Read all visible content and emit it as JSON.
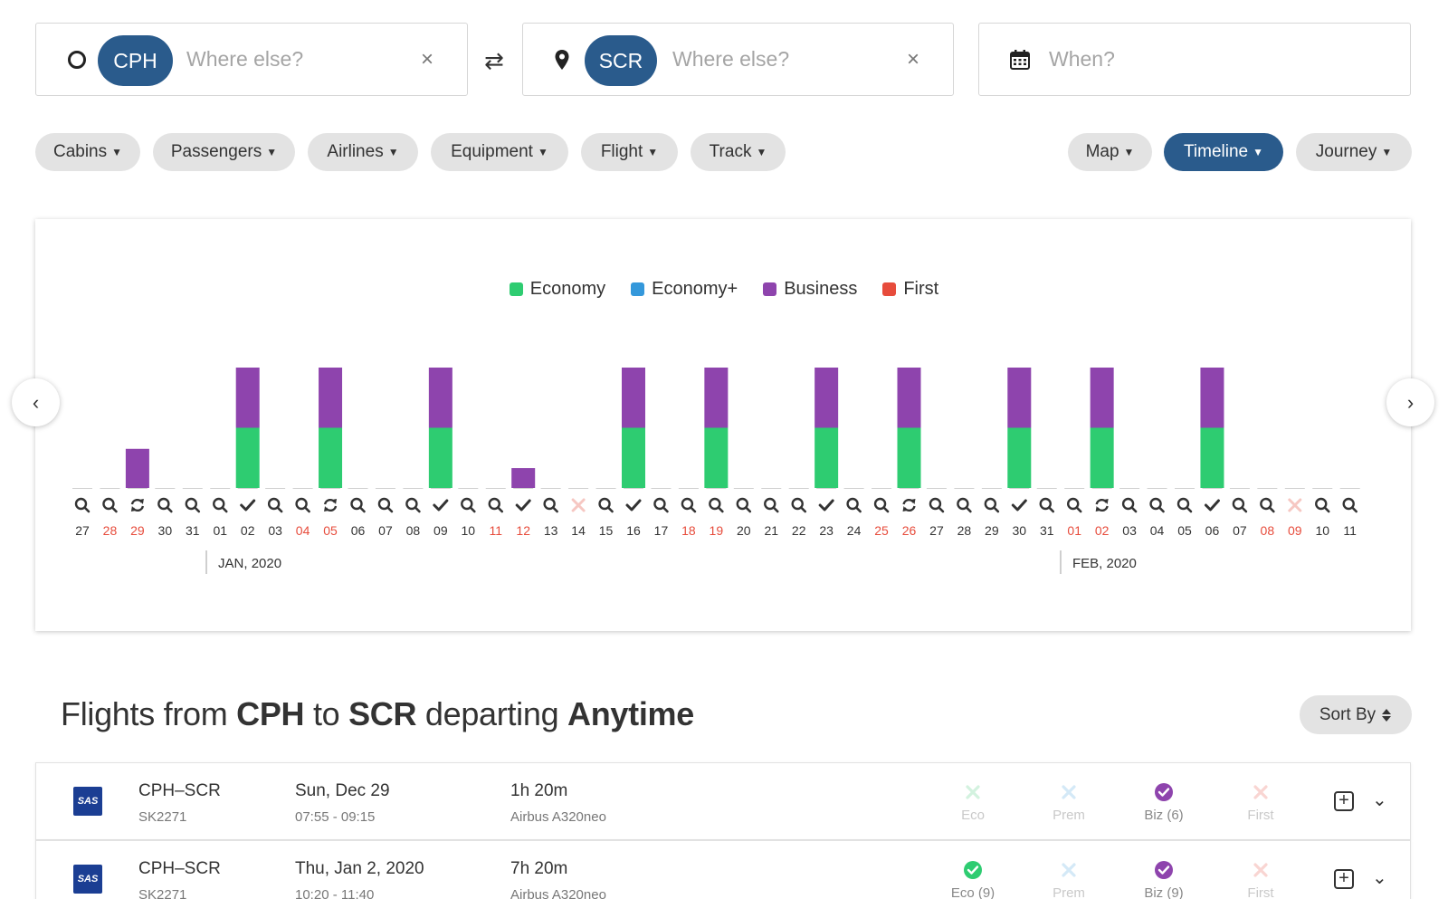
{
  "search": {
    "origin": {
      "code": "CPH",
      "placeholder": "Where else?",
      "clear": "×"
    },
    "swap": "⇄",
    "destination": {
      "code": "SCR",
      "placeholder": "Where else?",
      "clear": "×"
    },
    "when": {
      "placeholder": "When?"
    }
  },
  "filters": [
    "Cabins",
    "Passengers",
    "Airlines",
    "Equipment",
    "Flight",
    "Track"
  ],
  "views": {
    "items": [
      "Map",
      "Timeline",
      "Journey"
    ],
    "active": "Timeline"
  },
  "legend": [
    {
      "label": "Economy",
      "color": "#2ecc71"
    },
    {
      "label": "Economy+",
      "color": "#3498db"
    },
    {
      "label": "Business",
      "color": "#8e44ad"
    },
    {
      "label": "First",
      "color": "#e74c3c"
    }
  ],
  "chart_data": {
    "type": "bar",
    "stacked": true,
    "categories": [
      "27",
      "28",
      "29",
      "30",
      "31",
      "01",
      "02",
      "03",
      "04",
      "05",
      "06",
      "07",
      "08",
      "09",
      "10",
      "11",
      "12",
      "13",
      "14",
      "15",
      "16",
      "17",
      "18",
      "19",
      "20",
      "21",
      "22",
      "23",
      "24",
      "25",
      "26",
      "27",
      "28",
      "29",
      "30",
      "31",
      "01",
      "02",
      "03",
      "04",
      "05",
      "06",
      "07",
      "08",
      "09",
      "10",
      "11"
    ],
    "weekend": [
      false,
      true,
      true,
      false,
      false,
      false,
      false,
      false,
      true,
      true,
      false,
      false,
      false,
      false,
      false,
      true,
      true,
      false,
      false,
      false,
      false,
      false,
      true,
      true,
      false,
      false,
      false,
      false,
      false,
      true,
      true,
      false,
      false,
      false,
      false,
      false,
      true,
      true,
      false,
      false,
      false,
      false,
      false,
      true,
      true,
      false,
      false
    ],
    "status_icons": [
      "search",
      "search",
      "sync",
      "search",
      "search",
      "search",
      "check",
      "search",
      "search",
      "sync",
      "search",
      "search",
      "search",
      "check",
      "search",
      "search",
      "check",
      "search",
      "x",
      "search",
      "check",
      "search",
      "search",
      "search",
      "search",
      "search",
      "search",
      "check",
      "search",
      "search",
      "sync",
      "search",
      "search",
      "search",
      "check",
      "search",
      "search",
      "sync",
      "search",
      "search",
      "search",
      "check",
      "search",
      "search",
      "x",
      "search",
      "search"
    ],
    "series": [
      {
        "name": "Economy",
        "color": "#2ecc71",
        "values": [
          0,
          0,
          0,
          0,
          0,
          0,
          1,
          0,
          0,
          1,
          0,
          0,
          0,
          1,
          0,
          0,
          0,
          0,
          0,
          0,
          1,
          0,
          0,
          1,
          0,
          0,
          0,
          1,
          0,
          0,
          1,
          0,
          0,
          0,
          1,
          0,
          0,
          1,
          0,
          0,
          0,
          1,
          0,
          0,
          0,
          0,
          0
        ]
      },
      {
        "name": "Economy+",
        "color": "#3498db",
        "values": [
          0,
          0,
          0,
          0,
          0,
          0,
          0,
          0,
          0,
          0,
          0,
          0,
          0,
          0,
          0,
          0,
          0,
          0,
          0,
          0,
          0,
          0,
          0,
          0,
          0,
          0,
          0,
          0,
          0,
          0,
          0,
          0,
          0,
          0,
          0,
          0,
          0,
          0,
          0,
          0,
          0,
          0,
          0,
          0,
          0,
          0,
          0
        ]
      },
      {
        "name": "Business",
        "color": "#8e44ad",
        "values": [
          0,
          0,
          0.65,
          0,
          0,
          0,
          1,
          0,
          0,
          1,
          0,
          0,
          0,
          1,
          0,
          0,
          0.33,
          0,
          0,
          0,
          1,
          0,
          0,
          1,
          0,
          0,
          0,
          1,
          0,
          0,
          1,
          0,
          0,
          0,
          1,
          0,
          0,
          1,
          0,
          0,
          0,
          1,
          0,
          0,
          0,
          0,
          0
        ]
      },
      {
        "name": "First",
        "color": "#e74c3c",
        "values": [
          0,
          0,
          0,
          0,
          0,
          0,
          0,
          0,
          0,
          0,
          0,
          0,
          0,
          0,
          0,
          0,
          0,
          0,
          0,
          0,
          0,
          0,
          0,
          0,
          0,
          0,
          0,
          0,
          0,
          0,
          0,
          0,
          0,
          0,
          0,
          0,
          0,
          0,
          0,
          0,
          0,
          0,
          0,
          0,
          0,
          0,
          0
        ]
      }
    ],
    "month_labels": [
      {
        "label": "JAN, 2020",
        "index": 5
      },
      {
        "label": "FEB, 2020",
        "index": 36
      }
    ]
  },
  "results": {
    "title_parts": [
      "Flights from ",
      "CPH",
      " to ",
      "SCR",
      " departing ",
      "Anytime"
    ],
    "sort_label": "Sort By",
    "flights": [
      {
        "logo": "SAS",
        "route": "CPH–SCR",
        "flight_no": "SK2271",
        "date": "Sun, Dec 29",
        "time": "07:55 - 09:15",
        "duration": "1h 20m",
        "aircraft": "Airbus A320neo",
        "cabins": [
          {
            "label": "Eco",
            "status": "unavailable"
          },
          {
            "label": "Prem",
            "status": "unavailable"
          },
          {
            "label": "Biz (6)",
            "status": "available"
          },
          {
            "label": "First",
            "status": "unavailable"
          }
        ]
      },
      {
        "logo": "SAS",
        "route": "CPH–SCR",
        "flight_no": "SK2271",
        "date": "Thu, Jan 2, 2020",
        "time": "10:20 - 11:40",
        "duration": "7h 20m",
        "aircraft": "Airbus A320neo",
        "cabins": [
          {
            "label": "Eco (9)",
            "status": "available"
          },
          {
            "label": "Prem",
            "status": "unavailable"
          },
          {
            "label": "Biz (9)",
            "status": "available"
          },
          {
            "label": "First",
            "status": "unavailable"
          }
        ]
      }
    ]
  },
  "colors": {
    "brand": "#2a5b8c",
    "weekend": "#e74c3c",
    "eco_ok": "#2ecc71",
    "biz_ok": "#8e44ad",
    "prem_off": "#d4e9f7",
    "first_off": "#f9d5d2",
    "eco_off": "#d3f2df"
  }
}
